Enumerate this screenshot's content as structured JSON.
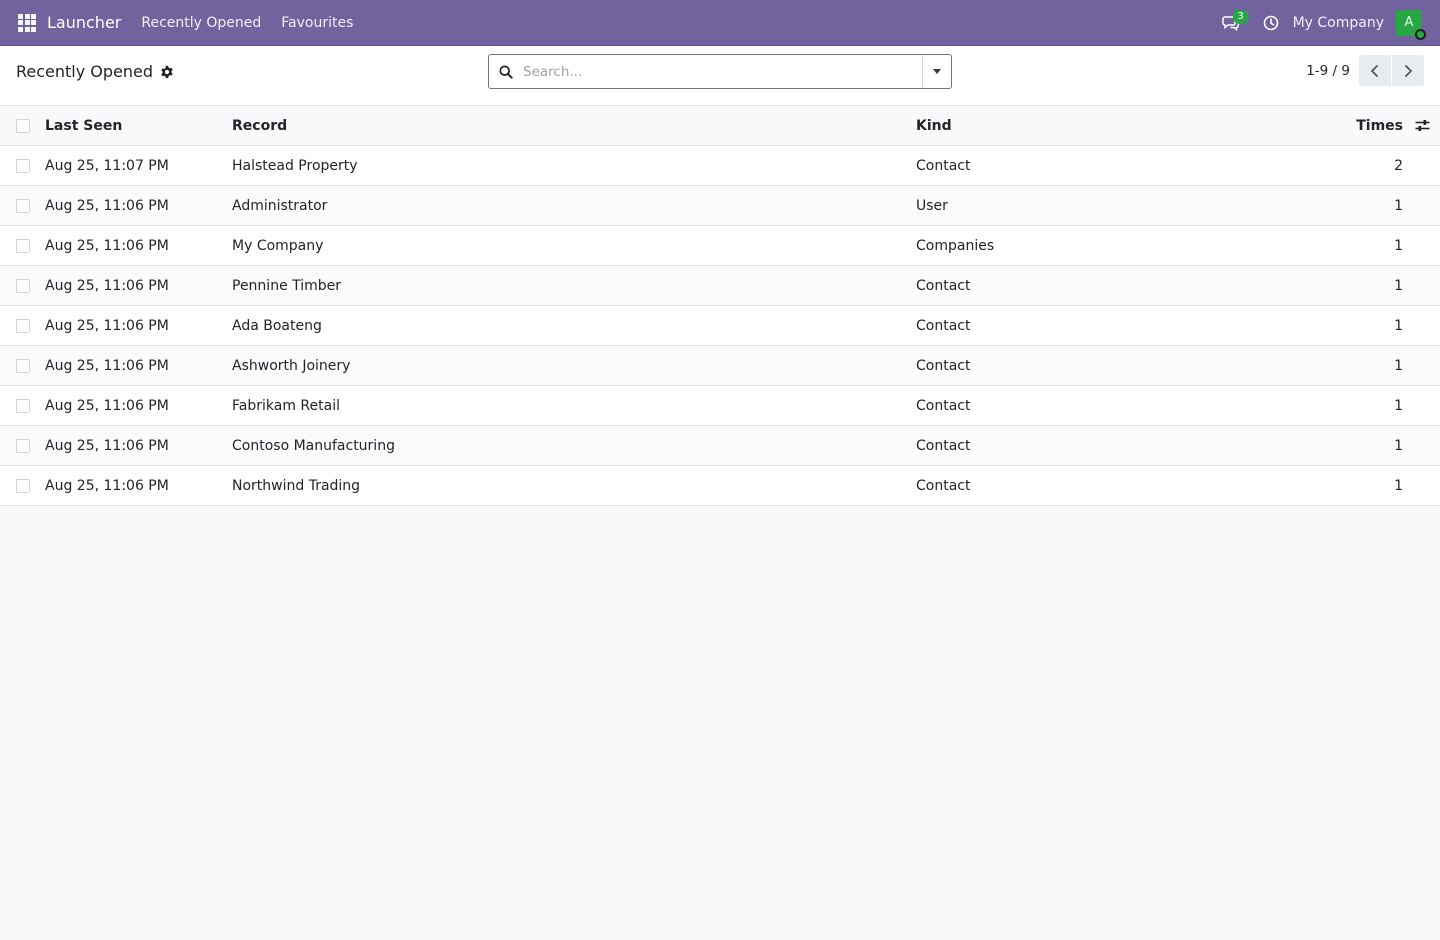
{
  "navbar": {
    "apps_icon": "apps-grid-icon",
    "brand": "Launcher",
    "menu": [
      "Recently Opened",
      "Favourites"
    ],
    "messages_icon": "chat-icon",
    "message_count": "3",
    "activity_icon": "clock-icon",
    "company": "My Company",
    "avatar_letter": "A",
    "colors": {
      "bar": "#71639e",
      "badge": "#28a745",
      "avatar": "#28a745"
    }
  },
  "control_panel": {
    "title": "Recently Opened",
    "settings_icon": "gear-icon",
    "search_placeholder": "Search...",
    "search_value": "",
    "pager_value": "1-9 / 9"
  },
  "table": {
    "columns": {
      "last_seen": "Last Seen",
      "record": "Record",
      "kind": "Kind",
      "times": "Times"
    },
    "optional_columns_icon": "sliders-icon",
    "rows": [
      {
        "last_seen": "Aug 25, 11:07 PM",
        "record": "Halstead Property",
        "kind": "Contact",
        "times": "2"
      },
      {
        "last_seen": "Aug 25, 11:06 PM",
        "record": "Administrator",
        "kind": "User",
        "times": "1"
      },
      {
        "last_seen": "Aug 25, 11:06 PM",
        "record": "My Company",
        "kind": "Companies",
        "times": "1"
      },
      {
        "last_seen": "Aug 25, 11:06 PM",
        "record": "Pennine Timber",
        "kind": "Contact",
        "times": "1"
      },
      {
        "last_seen": "Aug 25, 11:06 PM",
        "record": "Ada Boateng",
        "kind": "Contact",
        "times": "1"
      },
      {
        "last_seen": "Aug 25, 11:06 PM",
        "record": "Ashworth Joinery",
        "kind": "Contact",
        "times": "1"
      },
      {
        "last_seen": "Aug 25, 11:06 PM",
        "record": "Fabrikam Retail",
        "kind": "Contact",
        "times": "1"
      },
      {
        "last_seen": "Aug 25, 11:06 PM",
        "record": "Contoso Manufacturing",
        "kind": "Contact",
        "times": "1"
      },
      {
        "last_seen": "Aug 25, 11:06 PM",
        "record": "Northwind Trading",
        "kind": "Contact",
        "times": "1"
      }
    ]
  }
}
